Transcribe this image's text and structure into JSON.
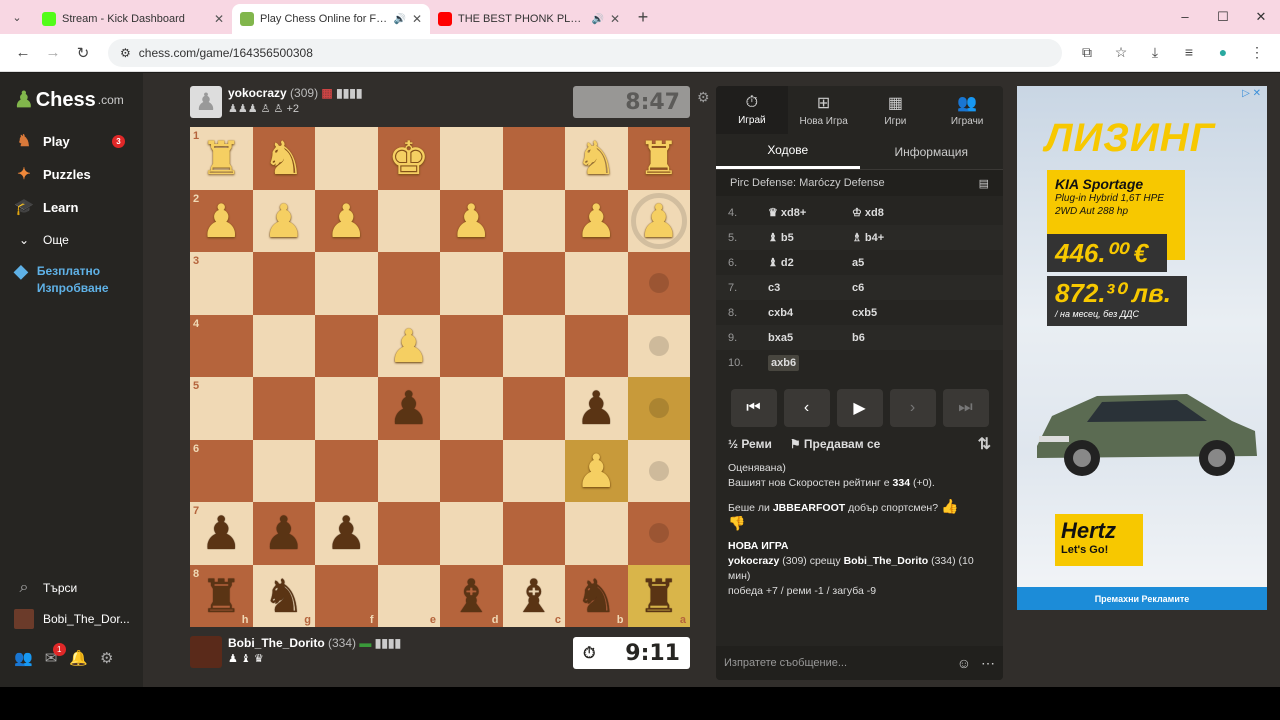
{
  "browser": {
    "tabs": [
      {
        "title": "Stream - Kick Dashboard",
        "favicon_color": "#53fc18"
      },
      {
        "title": "Play Chess Online for FREE",
        "favicon_color": "#81b64c"
      },
      {
        "title": "THE BEST PHONK PLAYLIST",
        "favicon_color": "#ff0000"
      }
    ],
    "url": "chess.com/game/164356500308"
  },
  "sidebar": {
    "logo": "Chess",
    "logo_suffix": ".com",
    "items": [
      {
        "label": "Play",
        "badge": "3"
      },
      {
        "label": "Puzzles"
      },
      {
        "label": "Learn"
      },
      {
        "label": "Още"
      }
    ],
    "free_trial": "Безплатно Изпробване",
    "search": "Търси",
    "user": "Bobi_The_Dor...",
    "mail_badge": "1"
  },
  "top_player": {
    "name": "yokocrazy",
    "rating": "(309)",
    "captured": "+2",
    "clock": "8:47"
  },
  "bottom_player": {
    "name": "Bobi_The_Dorito",
    "rating": "(334)",
    "clock": "9:11"
  },
  "board": {
    "files": [
      "h",
      "g",
      "f",
      "e",
      "d",
      "c",
      "b",
      "a"
    ],
    "ranks": [
      "1",
      "2",
      "3",
      "4",
      "5",
      "6",
      "7",
      "8"
    ]
  },
  "panel": {
    "tabs": [
      "Играй",
      "Нова Игра",
      "Игри",
      "Играчи"
    ],
    "subtabs": [
      "Ходове",
      "Информация"
    ],
    "opening": "Pirc Defense: Maróczy Defense",
    "moves": [
      {
        "n": "4.",
        "w": "♛ xd8+",
        "b": "♔ xd8"
      },
      {
        "n": "5.",
        "w": "♝ b5",
        "b": "♗ b4+"
      },
      {
        "n": "6.",
        "w": "♝ d2",
        "b": "a5"
      },
      {
        "n": "7.",
        "w": "c3",
        "b": "c6"
      },
      {
        "n": "8.",
        "w": "cxb4",
        "b": "cxb5"
      },
      {
        "n": "9.",
        "w": "bxa5",
        "b": "b6"
      },
      {
        "n": "10.",
        "w": "axb6",
        "b": ""
      }
    ],
    "draw": "Реми",
    "resign": "Предавам се",
    "chat": {
      "line1": "Оценявана)",
      "line2_pre": "Вашият нов Скоростен рейтинг е ",
      "line2_val": "334",
      "line2_post": " (+0).",
      "sport_pre": "Беше ли ",
      "sport_name": "JBBEARFOOT",
      "sport_post": " добър спортсмен?",
      "new_game": "НОВА ИГРА",
      "ng_p1": "yokocrazy",
      "ng_p1r": " (309) срещу ",
      "ng_p2": "Bobi_The_Dorito",
      "ng_p2r": " (334) (10 мин)",
      "stats": "победа +7 / реми -1 / загуба -9"
    },
    "message_placeholder": "Изпратете съобщение..."
  },
  "ad": {
    "headline": "ЛИЗИНГ",
    "model": "KIA Sportage",
    "spec1": "Plug-in Hybrid 1,6T HPE",
    "spec2": "2WD Aut 288 hp",
    "price1": "446.⁰⁰ €",
    "price2": "872.³⁰ лв.",
    "note": "/ на месец, без ДДС",
    "brand": "Hertz",
    "slogan": "Let's Go!",
    "remove": "Премахни Рекламите"
  }
}
